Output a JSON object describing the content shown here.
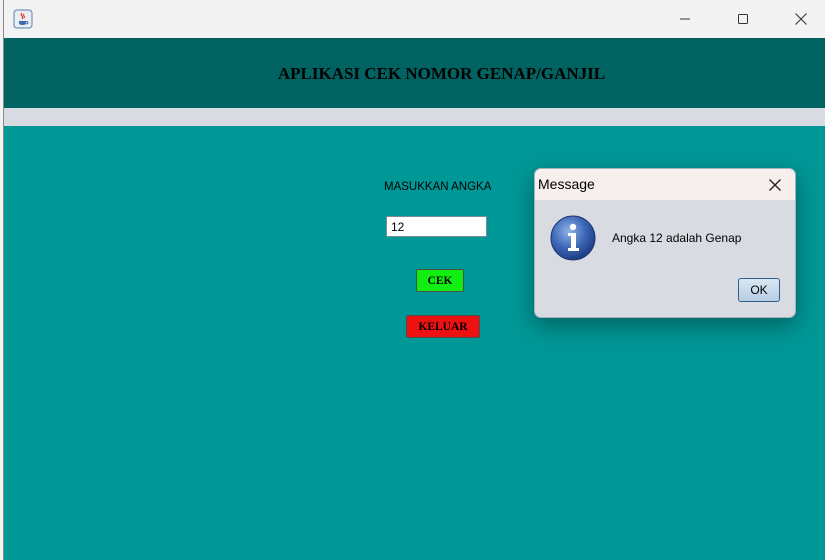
{
  "header": {
    "title": "APLIKASI CEK NOMOR GENAP/GANJIL"
  },
  "form": {
    "input_label": "MASUKKAN ANGKA",
    "input_value": "12",
    "cek_label": "CEK",
    "keluar_label": "KELUAR"
  },
  "dialog": {
    "title": "Message",
    "message": "Angka 12 adalah Genap",
    "ok_label": "OK"
  },
  "icons": {
    "app": "java-app-icon",
    "minimize": "minimize-icon",
    "maximize": "maximize-icon",
    "close": "close-icon",
    "dialog_close": "close-icon",
    "info": "info-icon"
  },
  "colors": {
    "window_background": "#009797",
    "header_background": "#006361",
    "cek_button": "#11ee11",
    "keluar_button": "#ee1111"
  }
}
